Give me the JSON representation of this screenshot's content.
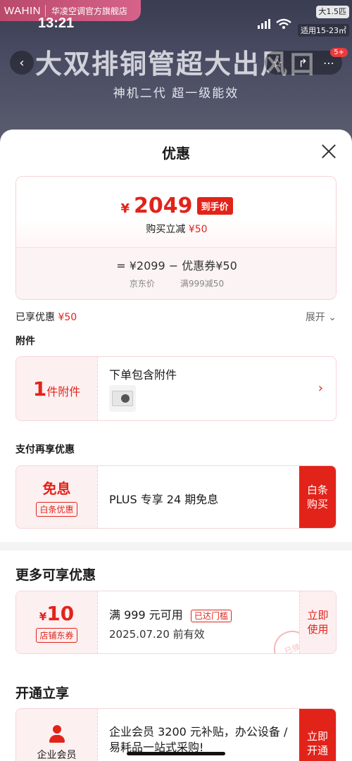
{
  "status_bar": {
    "time": "13:21",
    "ac_badge": "大1.5匹",
    "ac_note": "适用15-23㎡"
  },
  "banner": {
    "brand_logo": "WAHIN",
    "store_name": "华凌空调官方旗舰店",
    "headline": "大双排铜管超大出风口",
    "subheadline": "神机二代 超一级能效",
    "cart_count": "5+"
  },
  "sheet": {
    "title": "优惠",
    "price": {
      "currency": "¥",
      "final_price": "2049",
      "price_tag": "到手价",
      "cut_label": "购买立减",
      "cut_amount": "¥50",
      "formula": "=  ¥2099  −  优惠券¥50",
      "formula_left_label": "京东价",
      "formula_right_label": "满999减50"
    },
    "enjoyed": {
      "label": "已享优惠",
      "amount": "¥50",
      "expand": "展开"
    },
    "accessory": {
      "section_label": "附件",
      "count": "1",
      "unit_label": "件附件",
      "title": "下单包含附件"
    },
    "payment": {
      "section_label": "支付再享优惠",
      "left_big": "免息",
      "left_tag": "白条优惠",
      "title": "PLUS 专享 24 期免息",
      "cta": "白条购买"
    },
    "more": {
      "section_label": "更多可享优惠",
      "coupon": {
        "currency": "¥",
        "amount": "10",
        "type": "店铺东券",
        "condition": "满 999 元可用",
        "threshold_tag": "已达门槛",
        "expiry": "2025.07.20 前有效",
        "cta": "立即使用",
        "stamp": "已领"
      }
    },
    "open": {
      "section_label": "开通立享",
      "left_label": "企业会员",
      "title": "企业会员 3200 元补贴，办公设备 / 易耗品一站式采购!",
      "cta": "立即开通"
    }
  },
  "colors": {
    "accent": "#e2231a",
    "pink_bg": "#fdf0f1",
    "card_border": "#f5d5d8"
  }
}
